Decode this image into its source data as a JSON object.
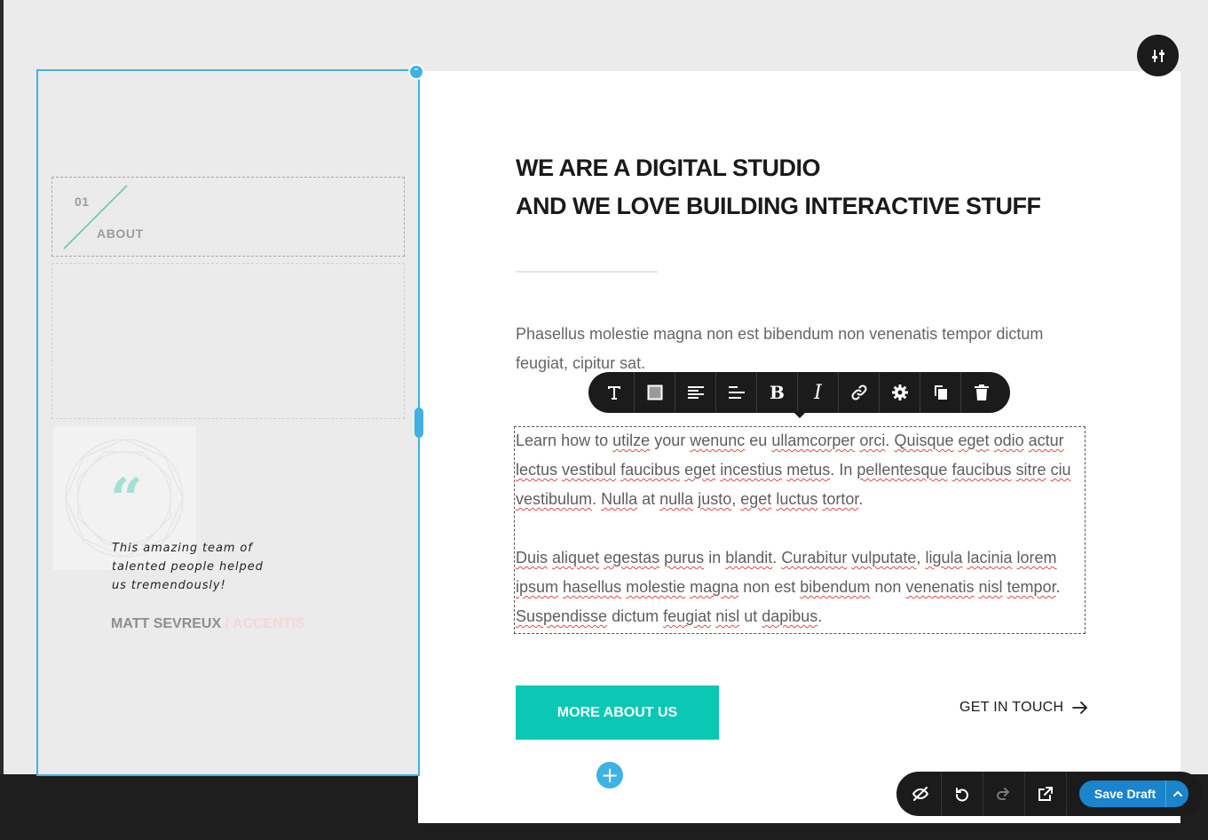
{
  "colors": {
    "accent": "#0ac8b3",
    "selection": "#3fb2e3",
    "toolbar": "#1b1b1b",
    "save": "#1a84cc"
  },
  "about_label": {
    "number": "01",
    "text": "ABOUT"
  },
  "testimonial": {
    "quote_mark": "“",
    "lines": [
      "This amazing team of",
      "talented people helped",
      "us tremendously!"
    ],
    "author": "MATT SEVREUX",
    "company": "/ ACCENTIS"
  },
  "heading": {
    "line1": "WE ARE A DIGITAL STUDIO",
    "line2": "AND WE LOVE BUILDING INTERACTIVE STUFF"
  },
  "intro": "Phasellus molestie magna non est bibendum non venenatis tempor dictum feugiat, cipitur sat.",
  "body": {
    "p1": "Learn how to utilze your wenunc eu ullamcorper orci. Quisque eget odio actur lectus vestibul faucibus eget incestius metus. In pellentesque faucibus sitre ciu vestibulum. Nulla at nulla justo, eget luctus tortor.",
    "p2": "Duis aliquet egestas purus in blandit. Curabitur vulputate, ligula lacinia lorem ipsum hasellus molestie magna non est bibendum non venenatis nisl tempor. Suspendisse dictum feugiat nisl ut dapibus."
  },
  "toolbar": [
    "text-icon",
    "box-icon",
    "align-left-icon",
    "align-indent-icon",
    "bold-icon",
    "italic-icon",
    "link-icon",
    "gear-icon",
    "duplicate-icon",
    "trash-icon"
  ],
  "buttons": {
    "more": "MORE ABOUT US",
    "touch": "GET IN TOUCH"
  },
  "bottom_bar": {
    "save": "Save Draft"
  }
}
